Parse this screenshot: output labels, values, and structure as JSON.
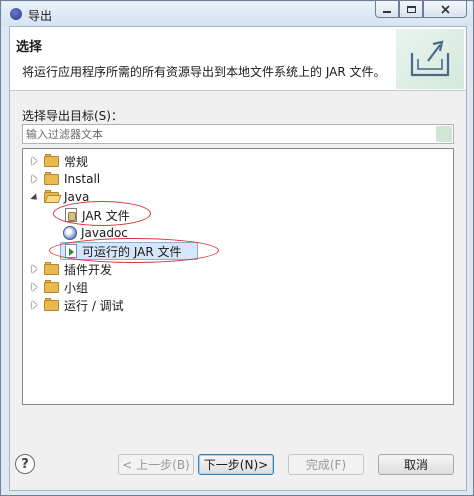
{
  "window": {
    "title": "导出"
  },
  "banner": {
    "title": "选择",
    "description": "将运行应用程序所需的所有资源导出到本地文件系统上的 JAR 文件。",
    "icon": "export-icon"
  },
  "target": {
    "label": "选择导出目标(S)："
  },
  "filter": {
    "placeholder": "输入过滤器文本",
    "value": ""
  },
  "tree": {
    "items": [
      {
        "label": "常规",
        "level": 0,
        "expanded": false,
        "icon": "folder-icon"
      },
      {
        "label": "Install",
        "level": 0,
        "expanded": false,
        "icon": "folder-icon"
      },
      {
        "label": "Java",
        "level": 0,
        "expanded": true,
        "icon": "folder-open-icon"
      },
      {
        "label": "JAR 文件",
        "level": 1,
        "icon": "jar-file-icon"
      },
      {
        "label": "Javadoc",
        "level": 1,
        "icon": "javadoc-icon"
      },
      {
        "label": "可运行的 JAR 文件",
        "level": 1,
        "icon": "runnable-jar-icon",
        "selected": true
      },
      {
        "label": "插件开发",
        "level": 0,
        "expanded": false,
        "icon": "folder-icon"
      },
      {
        "label": "小组",
        "level": 0,
        "expanded": false,
        "icon": "folder-icon"
      },
      {
        "label": "运行 / 调试",
        "level": 0,
        "expanded": false,
        "icon": "folder-icon"
      }
    ]
  },
  "buttons": {
    "back": "< 上一步(B)",
    "next": "下一步(N)>",
    "finish": "完成(F)",
    "cancel": "取消",
    "help": "?"
  },
  "colors": {
    "annotation": "#d9343d",
    "selection": "#d5e6fa",
    "folder": "#e8b94f"
  }
}
